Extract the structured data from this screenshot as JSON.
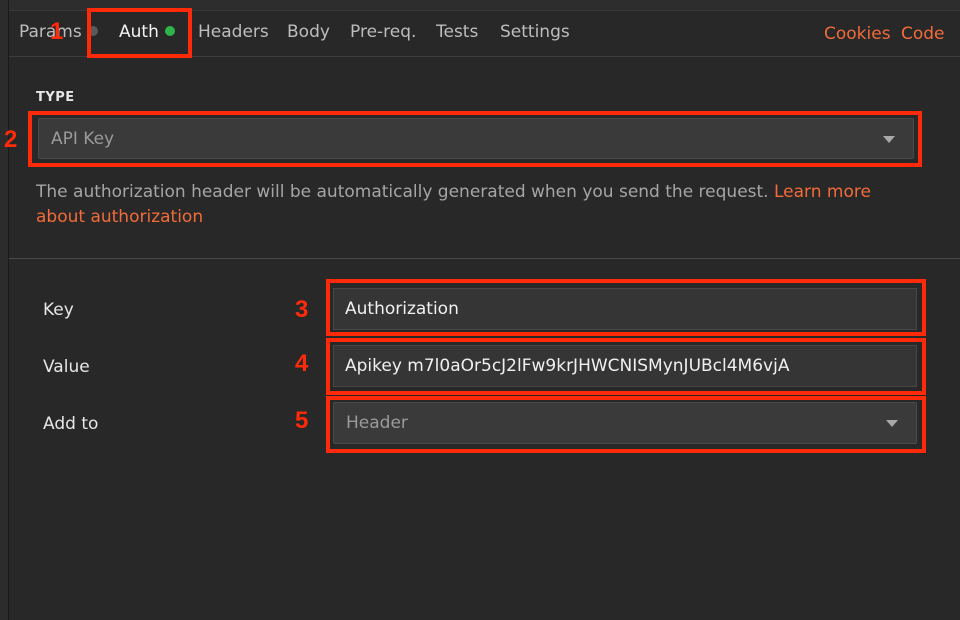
{
  "tabs": {
    "items": [
      {
        "label": "Params"
      },
      {
        "label": "Auth"
      },
      {
        "label": "Headers"
      },
      {
        "label": "Body"
      },
      {
        "label": "Pre-req."
      },
      {
        "label": "Tests"
      },
      {
        "label": "Settings"
      }
    ],
    "cookies_label": "Cookies",
    "code_label": "Code"
  },
  "auth": {
    "type_heading": "TYPE",
    "type_value": "API Key",
    "help_text": "The authorization header will be automatically generated when you send the request. ",
    "help_link": "Learn more about authorization",
    "key_label": "Key",
    "key_value": "Authorization",
    "value_label": "Value",
    "value_value": "Apikey m7l0aOr5cJ2lFw9krJHWCNISMynJUBcl4M6vjA",
    "addto_label": "Add to",
    "addto_value": "Header"
  },
  "annotations": [
    "1",
    "2",
    "3",
    "4",
    "5"
  ],
  "colors": {
    "accent": "#f26b3a",
    "annotation": "#ff2a0a",
    "dot_green": "#2fb44b",
    "dot_grey": "#5a5a5a"
  }
}
